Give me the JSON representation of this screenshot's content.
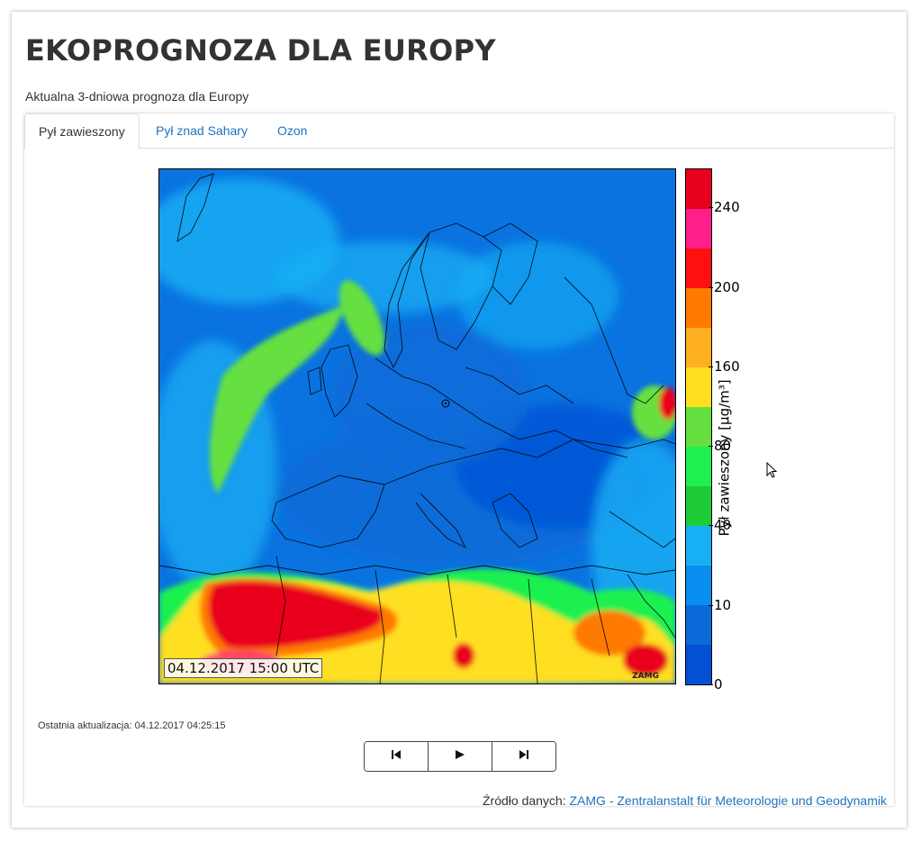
{
  "header": {
    "title": "EKOPROGNOZA DLA EUROPY",
    "subtitle": "Aktualna 3-dniowa prognoza dla Europy"
  },
  "tabs": [
    {
      "label": "Pył zawieszony",
      "active": true
    },
    {
      "label": "Pył znad Sahary",
      "active": false
    },
    {
      "label": "Ozon",
      "active": false
    }
  ],
  "map": {
    "timestamp": "04.12.2017 15:00 UTC",
    "watermark": "ZAMG"
  },
  "colorbar": {
    "label": "Pył zawieszony [µg/m³]",
    "ticks": [
      "240",
      "200",
      "160",
      "80",
      "40",
      "10",
      "0"
    ],
    "colors_top_to_bottom": [
      "#e8001f",
      "#ff1f8a",
      "#ff1010",
      "#ff7a00",
      "#ffb020",
      "#ffdf20",
      "#66e040",
      "#1ff050",
      "#1ecc3a",
      "#18b0f5",
      "#0a8ff0",
      "#0a6bd8",
      "#0450d4"
    ]
  },
  "status": {
    "last_update": "Ostatnia aktualizacja: 04.12.2017 04:25:15"
  },
  "controls": {
    "prev_icon": "skip-previous-icon",
    "play_icon": "play-icon",
    "next_icon": "skip-next-icon"
  },
  "source": {
    "prefix": "Źródło danych:",
    "link_text": "ZAMG - Zentralanstalt für Meteorologie und Geodynamik"
  }
}
